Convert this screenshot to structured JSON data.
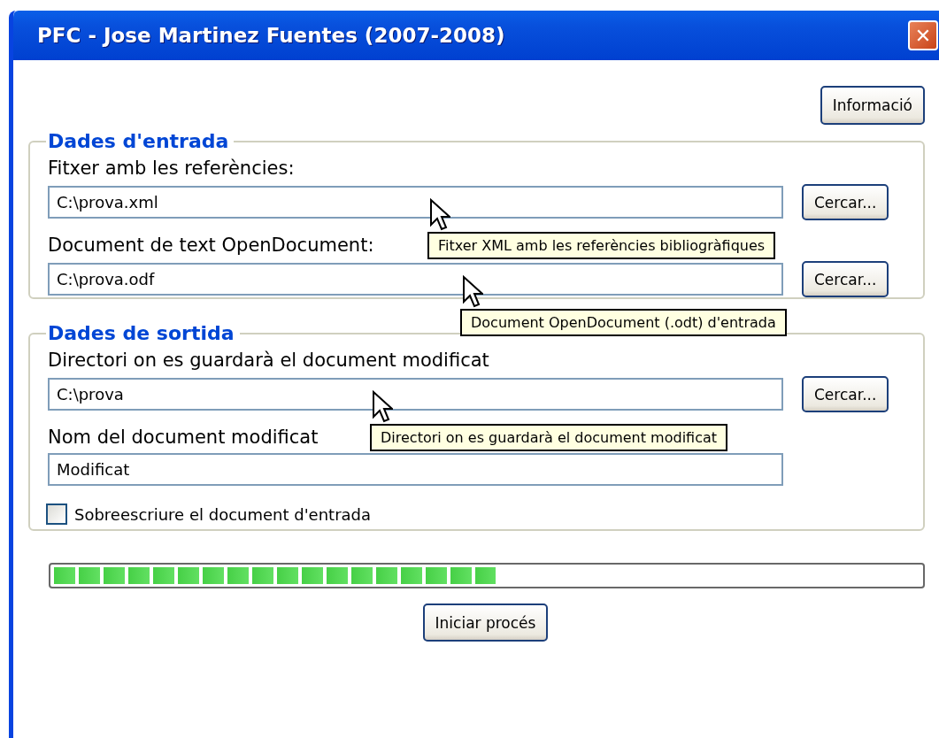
{
  "window": {
    "title": "PFC - Jose Martinez Fuentes (2007-2008)",
    "close": "✕"
  },
  "info_button": "Informació",
  "groups": [
    {
      "legend": "Dades d'entrada",
      "fields": [
        {
          "label": "Fitxer amb les referències:",
          "value": "C:\\prova.xml",
          "button": "Cercar...",
          "tooltip": "Fitxer XML amb les referències bibliogràfiques"
        },
        {
          "label": "Document de text OpenDocument:",
          "value": "C:\\prova.odf",
          "button": "Cercar...",
          "tooltip": "Document OpenDocument (.odt) d'entrada"
        }
      ]
    },
    {
      "legend": "Dades de sortida",
      "fields": [
        {
          "label": "Directori on es guardarà el document modificat",
          "value": "C:\\prova",
          "button": "Cercar...",
          "tooltip": "Directori on es guardarà el document modificat"
        },
        {
          "label": "Nom del document modificat",
          "value": "Modificat"
        }
      ],
      "checkbox": {
        "label": "Sobreescriure el document d'entrada",
        "checked": false
      }
    }
  ],
  "progress": {
    "level": 0.51
  },
  "start_button": "Iniciar procés"
}
